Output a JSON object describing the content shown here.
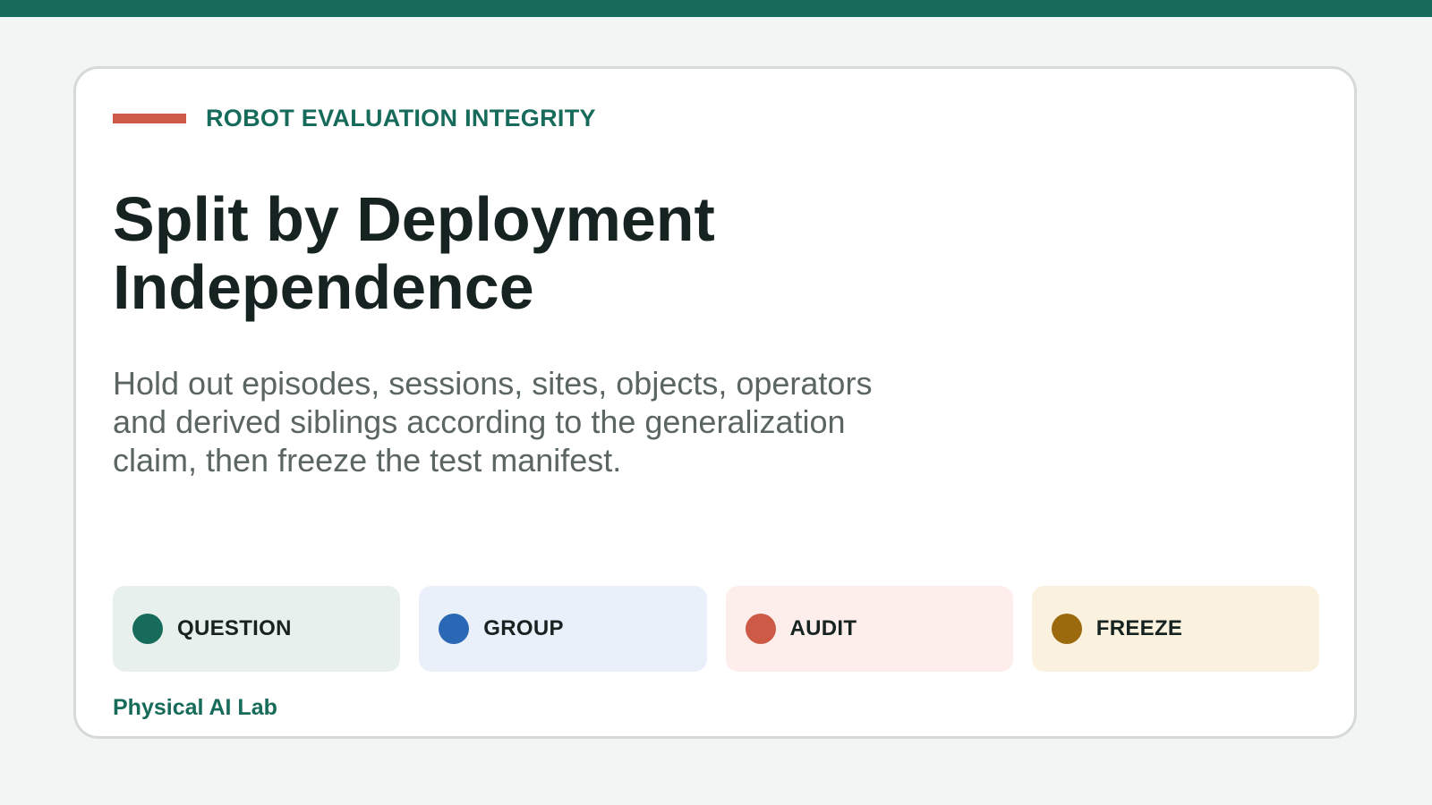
{
  "colors": {
    "top_bar": "#176b5a",
    "accent": "#cc5a46",
    "brand": "#176b5a"
  },
  "kicker": "ROBOT EVALUATION INTEGRITY",
  "title_lines": [
    "Split by Deployment",
    "Independence"
  ],
  "subtitle_lines": [
    "Hold out episodes, sessions, sites, objects, operators",
    "and derived siblings according to the generalization",
    "claim, then freeze the test manifest."
  ],
  "steps": [
    {
      "label": "QUESTION",
      "dot_color": "#176b5a",
      "bg_color": "#e8f0ed"
    },
    {
      "label": "GROUP",
      "dot_color": "#2a67b5",
      "bg_color": "#e9f0fa"
    },
    {
      "label": "AUDIT",
      "dot_color": "#cc5a46",
      "bg_color": "#fdeeeb"
    },
    {
      "label": "FREEZE",
      "dot_color": "#9a6a0c",
      "bg_color": "#faf1de"
    }
  ],
  "footer": "Physical AI Lab"
}
